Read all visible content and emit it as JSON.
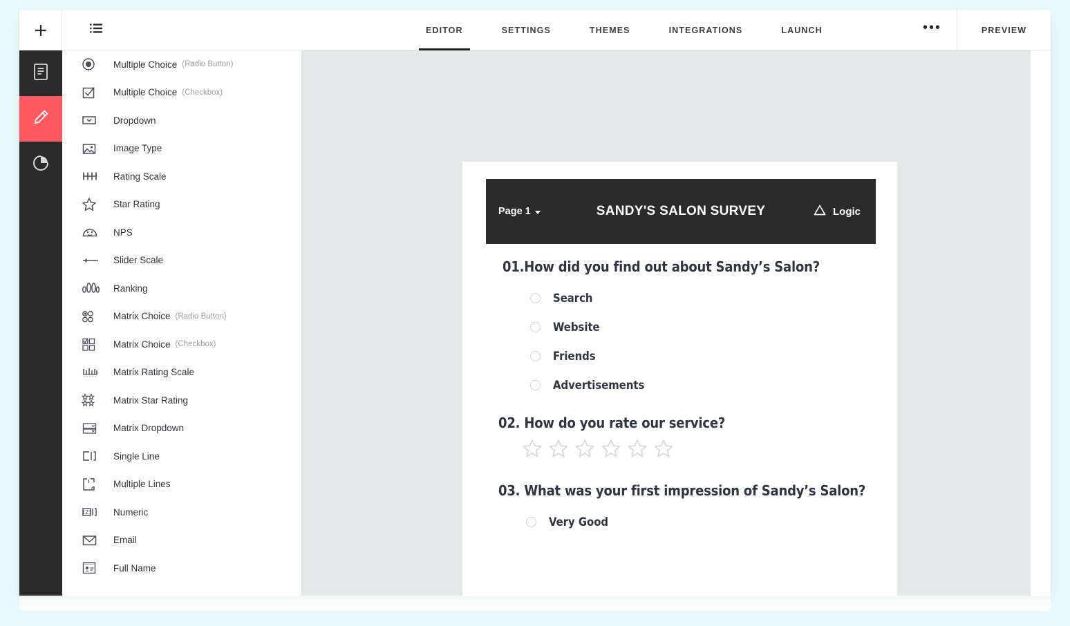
{
  "colors": {
    "page_background": "#e8fafc",
    "rail_background": "#2b2b2b",
    "rail_active": "#ff5a5f",
    "canvas_background": "#e4e8e8",
    "survey_header_background": "#2b2b2b",
    "text_dark": "#2f3440",
    "muted_text": "#9a9da3"
  },
  "topbar": {
    "add_button": {
      "icon": "plus-icon",
      "label": "+"
    },
    "list_toggle": {
      "icon": "list-icon"
    },
    "tabs": [
      {
        "label": "EDITOR",
        "active": true
      },
      {
        "label": "SETTINGS",
        "active": false
      },
      {
        "label": "THEMES",
        "active": false
      },
      {
        "label": "INTEGRATIONS",
        "active": false
      },
      {
        "label": "LAUNCH",
        "active": false
      }
    ],
    "more_button": {
      "icon": "ellipsis-icon",
      "label": "•••"
    },
    "preview_button": {
      "label": "PREVIEW"
    }
  },
  "rail": {
    "items": [
      {
        "icon": "document-icon",
        "name": "pages",
        "active": false
      },
      {
        "icon": "pencil-icon",
        "name": "editor",
        "active": true
      },
      {
        "icon": "pie-chart-icon",
        "name": "results",
        "active": false
      }
    ]
  },
  "question_types": [
    {
      "icon": "radio-button-icon",
      "label": "Multiple Choice",
      "sub": "(Radio Button)"
    },
    {
      "icon": "checkbox-icon",
      "label": "Multiple Choice",
      "sub": "(Checkbox)"
    },
    {
      "icon": "dropdown-icon",
      "label": "Dropdown",
      "sub": ""
    },
    {
      "icon": "image-icon",
      "label": "Image Type",
      "sub": ""
    },
    {
      "icon": "rating-scale-icon",
      "label": "Rating Scale",
      "sub": ""
    },
    {
      "icon": "star-icon",
      "label": "Star Rating",
      "sub": ""
    },
    {
      "icon": "nps-gauge-icon",
      "label": "NPS",
      "sub": ""
    },
    {
      "icon": "slider-icon",
      "label": "Slider Scale",
      "sub": ""
    },
    {
      "icon": "ranking-icon",
      "label": "Ranking",
      "sub": ""
    },
    {
      "icon": "matrix-radio-icon",
      "label": "Matrix Choice",
      "sub": "(Radio Button)"
    },
    {
      "icon": "matrix-checkbox-icon",
      "label": "Matrix Choice",
      "sub": "(Checkbox)"
    },
    {
      "icon": "matrix-rating-icon",
      "label": "Matrix Rating Scale",
      "sub": ""
    },
    {
      "icon": "matrix-star-icon",
      "label": "Matrix Star Rating",
      "sub": ""
    },
    {
      "icon": "matrix-dropdown-icon",
      "label": "Matrix Dropdown",
      "sub": ""
    },
    {
      "icon": "single-line-icon",
      "label": "Single Line",
      "sub": ""
    },
    {
      "icon": "multiple-lines-icon",
      "label": "Multiple Lines",
      "sub": ""
    },
    {
      "icon": "numeric-icon",
      "label": "Numeric",
      "sub": ""
    },
    {
      "icon": "email-icon",
      "label": "Email",
      "sub": ""
    },
    {
      "icon": "full-name-icon",
      "label": "Full Name",
      "sub": ""
    }
  ],
  "survey": {
    "page_selector": "Page 1",
    "title": "SANDY'S SALON SURVEY",
    "logic_label": "Logic",
    "logic_icon": "triangle-logic-icon",
    "questions": [
      {
        "type": "radio",
        "title": "01.How did you find out about Sandy’s Salon?",
        "options": [
          "Search",
          "Website",
          "Friends",
          "Advertisements"
        ]
      },
      {
        "type": "star",
        "title": "02. How do you rate our service?",
        "star_count": 6
      },
      {
        "type": "radio",
        "title": "03. What was your first impression of Sandy’s Salon?",
        "options": [
          "Very Good"
        ]
      }
    ]
  }
}
